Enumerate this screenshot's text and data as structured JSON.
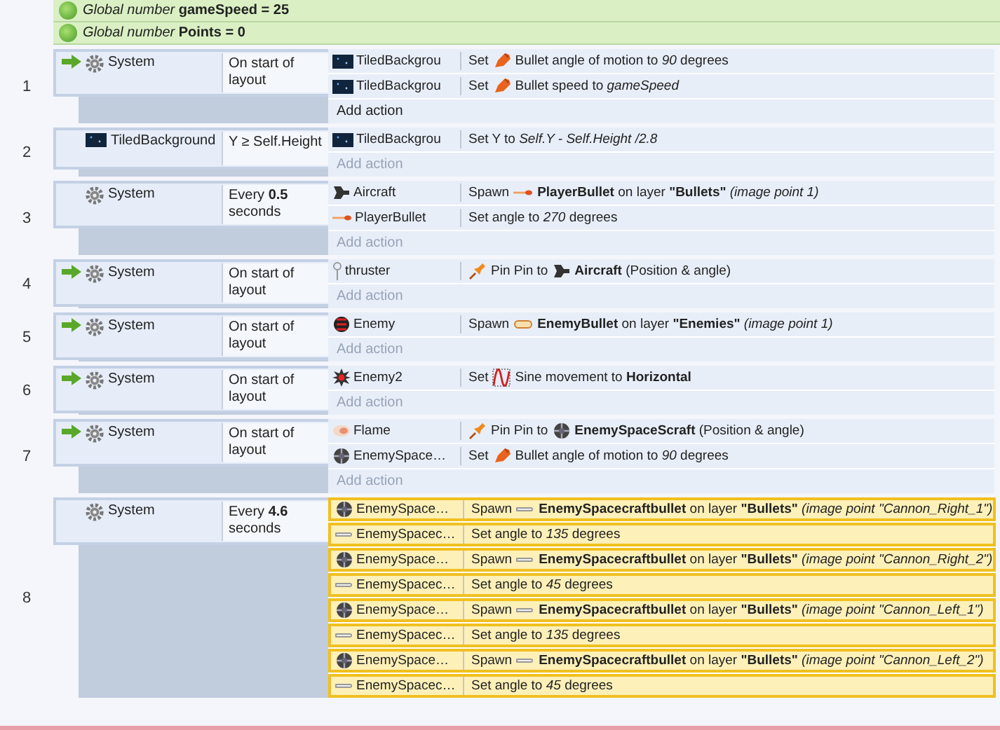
{
  "globals": [
    "*Global number* **gameSpeed = 25**",
    "*Global number* **Points = 0**"
  ],
  "events": [
    {
      "number": "1",
      "trigger": true,
      "object": {
        "kind": "gear",
        "name": "System"
      },
      "condition": "On start of layout",
      "actions": [
        {
          "kind": "tiled",
          "object": "TiledBackgrou",
          "selected": false,
          "parts": [
            {
              "kind": "text",
              "text": "Set"
            },
            {
              "kind": "rocket"
            },
            {
              "kind": "text",
              "text": "Bullet angle of motion to *90* degrees"
            }
          ]
        },
        {
          "kind": "tiled",
          "object": "TiledBackgrou",
          "selected": false,
          "parts": [
            {
              "kind": "text",
              "text": "Set"
            },
            {
              "kind": "rocket"
            },
            {
              "kind": "text",
              "text": "Bullet speed to *gameSpeed*"
            }
          ]
        }
      ],
      "add_action": {
        "label": "Add action",
        "dimmed": false
      }
    },
    {
      "number": "2",
      "trigger": false,
      "object": {
        "kind": "tiled",
        "name": "TiledBackground"
      },
      "condition": "Y ≥ Self.Height",
      "actions": [
        {
          "kind": "tiled",
          "object": "TiledBackgrou",
          "selected": false,
          "parts": [
            {
              "kind": "text",
              "text": "Set Y to *Self.Y - Self.Height /2.8*"
            }
          ]
        }
      ],
      "add_action": {
        "label": "Add action",
        "dimmed": true
      }
    },
    {
      "number": "3",
      "trigger": false,
      "object": {
        "kind": "gear",
        "name": "System"
      },
      "condition": "Every **0.5** seconds",
      "actions": [
        {
          "kind": "aircraft",
          "object": "Aircraft",
          "selected": false,
          "parts": [
            {
              "kind": "text",
              "text": "Spawn"
            },
            {
              "kind": "bullet"
            },
            {
              "kind": "text",
              "text": "**PlayerBullet** on layer **\"Bullets\"** *(image point 1)*"
            }
          ]
        },
        {
          "kind": "bullet",
          "object": "PlayerBullet",
          "selected": false,
          "parts": [
            {
              "kind": "text",
              "text": "Set angle to *270* degrees"
            }
          ]
        }
      ],
      "add_action": {
        "label": "Add action",
        "dimmed": true
      }
    },
    {
      "number": "4",
      "trigger": true,
      "object": {
        "kind": "gear",
        "name": "System"
      },
      "condition": "On start of layout",
      "actions": [
        {
          "kind": "pin",
          "object": "thruster",
          "selected": false,
          "parts": [
            {
              "kind": "pushpin"
            },
            {
              "kind": "text",
              "text": "Pin Pin to"
            },
            {
              "kind": "aircraft"
            },
            {
              "kind": "text",
              "text": "**Aircraft** (Position & angle)"
            }
          ]
        }
      ],
      "add_action": {
        "label": "Add action",
        "dimmed": true
      }
    },
    {
      "number": "5",
      "trigger": true,
      "object": {
        "kind": "gear",
        "name": "System"
      },
      "condition": "On start of layout",
      "actions": [
        {
          "kind": "enemy",
          "object": "Enemy",
          "selected": false,
          "parts": [
            {
              "kind": "text",
              "text": "Spawn"
            },
            {
              "kind": "capsule"
            },
            {
              "kind": "text",
              "text": "**EnemyBullet** on layer **\"Enemies\"** *(image point 1)*"
            }
          ]
        }
      ],
      "add_action": {
        "label": "Add action",
        "dimmed": true
      }
    },
    {
      "number": "6",
      "trigger": true,
      "object": {
        "kind": "gear",
        "name": "System"
      },
      "condition": "On start of layout",
      "actions": [
        {
          "kind": "enemy2",
          "object": "Enemy2",
          "selected": false,
          "parts": [
            {
              "kind": "text",
              "text": "Set"
            },
            {
              "kind": "sine"
            },
            {
              "kind": "text",
              "text": "Sine movement to **Horizontal**"
            }
          ]
        }
      ],
      "add_action": {
        "label": "Add action",
        "dimmed": true
      }
    },
    {
      "number": "7",
      "trigger": true,
      "object": {
        "kind": "gear",
        "name": "System"
      },
      "condition": "On start of layout",
      "actions": [
        {
          "kind": "flame",
          "object": "Flame",
          "selected": false,
          "parts": [
            {
              "kind": "pushpin"
            },
            {
              "kind": "text",
              "text": "Pin Pin to"
            },
            {
              "kind": "ship"
            },
            {
              "kind": "text",
              "text": "**EnemySpaceScraft** (Position & angle)"
            }
          ]
        },
        {
          "kind": "ship",
          "object": "EnemySpace…",
          "selected": false,
          "parts": [
            {
              "kind": "text",
              "text": "Set"
            },
            {
              "kind": "rocket"
            },
            {
              "kind": "text",
              "text": "Bullet angle of motion to *90* degrees"
            }
          ]
        }
      ],
      "add_action": {
        "label": "Add action",
        "dimmed": true
      }
    },
    {
      "number": "8",
      "trigger": false,
      "object": {
        "kind": "gear",
        "name": "System"
      },
      "condition": "Every **4.6** seconds",
      "actions": [
        {
          "kind": "ship",
          "object": "EnemySpace…",
          "selected": true,
          "parts": [
            {
              "kind": "text",
              "text": "Spawn"
            },
            {
              "kind": "thin"
            },
            {
              "kind": "text",
              "text": "**EnemySpacecraftbullet** on layer **\"Bullets\"** *(image point \"Cannon_Right_1\")*"
            }
          ]
        },
        {
          "kind": "thin",
          "object": "EnemySpacec…",
          "selected": true,
          "parts": [
            {
              "kind": "text",
              "text": "Set angle to *135* degrees"
            }
          ]
        },
        {
          "kind": "ship",
          "object": "EnemySpace…",
          "selected": true,
          "parts": [
            {
              "kind": "text",
              "text": "Spawn"
            },
            {
              "kind": "thin"
            },
            {
              "kind": "text",
              "text": "**EnemySpacecraftbullet** on layer **\"Bullets\"** *(image point \"Cannon_Right_2\")*"
            }
          ]
        },
        {
          "kind": "thin",
          "object": "EnemySpacec…",
          "selected": true,
          "parts": [
            {
              "kind": "text",
              "text": "Set angle to *45* degrees"
            }
          ]
        },
        {
          "kind": "ship",
          "object": "EnemySpace…",
          "selected": true,
          "parts": [
            {
              "kind": "text",
              "text": "Spawn"
            },
            {
              "kind": "thin"
            },
            {
              "kind": "text",
              "text": "**EnemySpacecraftbullet** on layer **\"Bullets\"** *(image point \"Cannon_Left_1\")*"
            }
          ]
        },
        {
          "kind": "thin",
          "object": "EnemySpacec…",
          "selected": true,
          "parts": [
            {
              "kind": "text",
              "text": "Set angle to *135* degrees"
            }
          ]
        },
        {
          "kind": "ship",
          "object": "EnemySpace…",
          "selected": true,
          "parts": [
            {
              "kind": "text",
              "text": "Spawn"
            },
            {
              "kind": "thin"
            },
            {
              "kind": "text",
              "text": "**EnemySpacecraftbullet** on layer **\"Bullets\"** *(image point \"Cannon_Left_2\")*"
            }
          ]
        },
        {
          "kind": "thin",
          "object": "EnemySpacec…",
          "selected": true,
          "parts": [
            {
              "kind": "text",
              "text": "Set angle to *45* degrees"
            }
          ]
        }
      ]
    }
  ]
}
